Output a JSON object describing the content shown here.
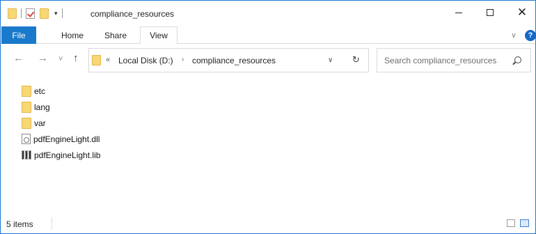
{
  "window": {
    "title": "compliance_resources"
  },
  "titlebar": {
    "quick_access": [
      "folder-icon",
      "properties-icon",
      "new-folder-icon"
    ],
    "minimize_label": "—",
    "maximize_label": "",
    "close_label": "✕"
  },
  "ribbon": {
    "tabs": [
      {
        "label": "File",
        "active": false,
        "accent": "#1979ca"
      },
      {
        "label": "Home",
        "active": false
      },
      {
        "label": "Share",
        "active": false
      },
      {
        "label": "View",
        "active": true
      }
    ],
    "help_label": "?"
  },
  "address_bar": {
    "back_label": "←",
    "forward_label": "→",
    "recent_label": "˅",
    "up_label": "↑",
    "overflow_label": "«",
    "crumbs": [
      "Local Disk (D:)",
      "compliance_resources"
    ],
    "crumb_separator": "›",
    "dropdown_label": "∨",
    "refresh_label": "↻"
  },
  "search": {
    "placeholder": "Search compliance_resources"
  },
  "files": [
    {
      "name": "etc",
      "type": "folder"
    },
    {
      "name": "lang",
      "type": "folder"
    },
    {
      "name": "var",
      "type": "folder"
    },
    {
      "name": "pdfEngineLight.dll",
      "type": "dll"
    },
    {
      "name": "pdfEngineLight.lib",
      "type": "lib"
    }
  ],
  "status": {
    "item_count": "5 items"
  },
  "colors": {
    "accent": "#1979ca",
    "folder": "#f8d775",
    "window_border": "#1e78d7"
  }
}
